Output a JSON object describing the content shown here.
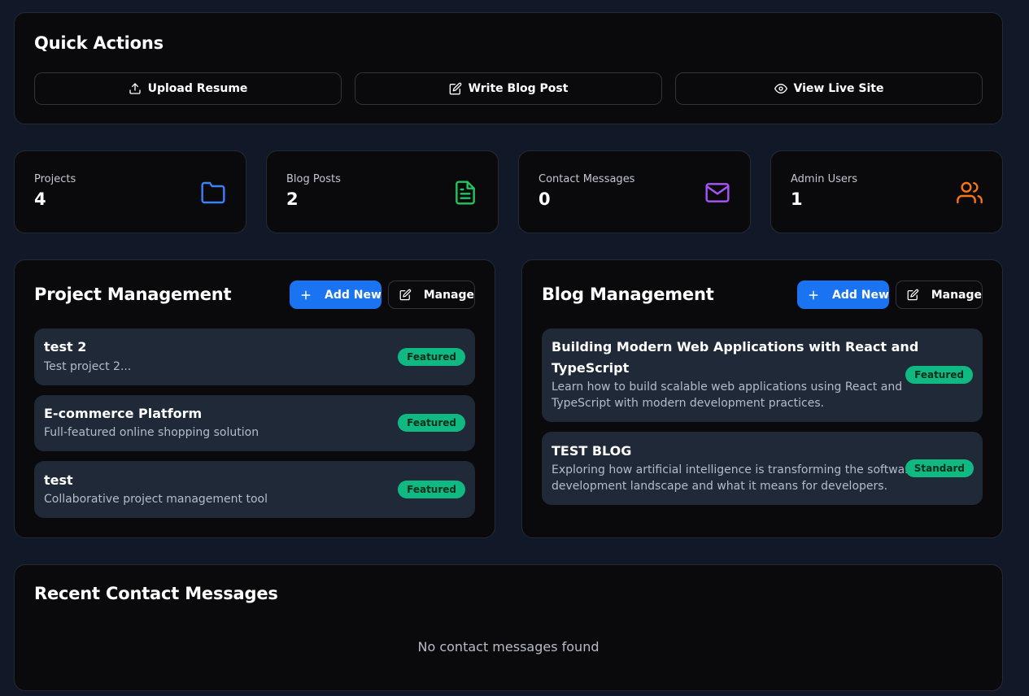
{
  "quick_actions": {
    "title": "Quick Actions",
    "buttons": [
      {
        "label": "Upload Resume",
        "icon": "upload-icon"
      },
      {
        "label": "Write Blog Post",
        "icon": "edit-icon"
      },
      {
        "label": "View Live Site",
        "icon": "eye-icon"
      }
    ]
  },
  "stats": [
    {
      "label": "Projects",
      "value": "4",
      "icon": "folder-icon",
      "color": "#3b82f6"
    },
    {
      "label": "Blog Posts",
      "value": "2",
      "icon": "file-text-icon",
      "color": "#22c55e"
    },
    {
      "label": "Contact Messages",
      "value": "0",
      "icon": "mail-icon",
      "color": "#a855f7"
    },
    {
      "label": "Admin Users",
      "value": "1",
      "icon": "users-icon",
      "color": "#f97316"
    }
  ],
  "project_management": {
    "title": "Project Management",
    "add_label": "Add New",
    "manage_label": "Manage",
    "items": [
      {
        "title": "test 2",
        "description": "Test project 2...",
        "badge": "Featured"
      },
      {
        "title": "E-commerce Platform",
        "description": "Full-featured online shopping solution",
        "badge": "Featured"
      },
      {
        "title": "test",
        "description": "Collaborative project management tool",
        "badge": "Featured"
      }
    ]
  },
  "blog_management": {
    "title": "Blog Management",
    "add_label": "Add New",
    "manage_label": "Manage",
    "items": [
      {
        "title_line1": "Building Modern Web Applications with React and",
        "title_line2": "TypeScript",
        "desc_line1": "Learn how to build scalable web applications using React and",
        "desc_line2": "TypeScript with modern development practices.",
        "badge": "Featured"
      },
      {
        "title_line1": "TEST BLOG",
        "desc_line1": "Exploring how artificial intelligence is transforming the software",
        "desc_line2": "development landscape and what it means for developers.",
        "badge": "Standard"
      }
    ]
  },
  "recent_messages": {
    "title": "Recent Contact Messages",
    "empty_text": "No contact messages found"
  },
  "colors": {
    "background": "#111827",
    "card": "#0a0a0c",
    "item": "#1f2937",
    "accent": "#1a73f0",
    "badge": "#10b981"
  }
}
